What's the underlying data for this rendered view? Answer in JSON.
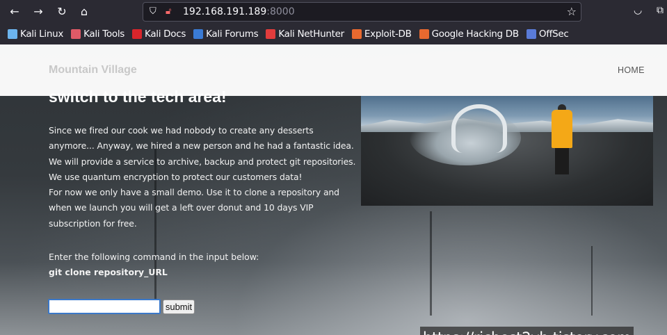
{
  "browser": {
    "url_host": "192.168.191.189",
    "url_port": ":8000",
    "bookmarks": [
      {
        "label": "Kali Linux",
        "icon": "kali-dragon-icon",
        "color": "#6cb4ee"
      },
      {
        "label": "Kali Tools",
        "icon": "kali-tools-icon",
        "color": "#e05a67"
      },
      {
        "label": "Kali Docs",
        "icon": "kali-docs-icon",
        "color": "#d9252b"
      },
      {
        "label": "Kali Forums",
        "icon": "kali-forums-icon",
        "color": "#3a7bd5"
      },
      {
        "label": "Kali NetHunter",
        "icon": "nethunter-icon",
        "color": "#e23c3c"
      },
      {
        "label": "Exploit-DB",
        "icon": "exploit-db-icon",
        "color": "#e8692f"
      },
      {
        "label": "Google Hacking DB",
        "icon": "ghdb-icon",
        "color": "#e8692f"
      },
      {
        "label": "OffSec",
        "icon": "offsec-icon",
        "color": "#5a7bd8"
      }
    ]
  },
  "site": {
    "brand": "Mountain Village",
    "nav_home": "HOME",
    "headline": "switch to the tech area!",
    "intro_lines": [
      "Since we fired our cook we had nobody to create any desserts",
      "anymore... Anyway, we hired a new person and he had a fantastic idea.",
      "We will provide a service to archive, backup and protect git repositories.",
      "We use quantum encryption to protect our customers data!",
      "For now we only have a small demo. Use it to clone a repository and",
      "when we launch you will get a left over donut and 10 days VIP",
      "subscription for free."
    ],
    "instruction": "Enter the following command in the input below:",
    "command": "git clone repository_URL",
    "input_value": "",
    "submit_label": "submit"
  },
  "watermark": "https://richest2yh.tistory.com"
}
